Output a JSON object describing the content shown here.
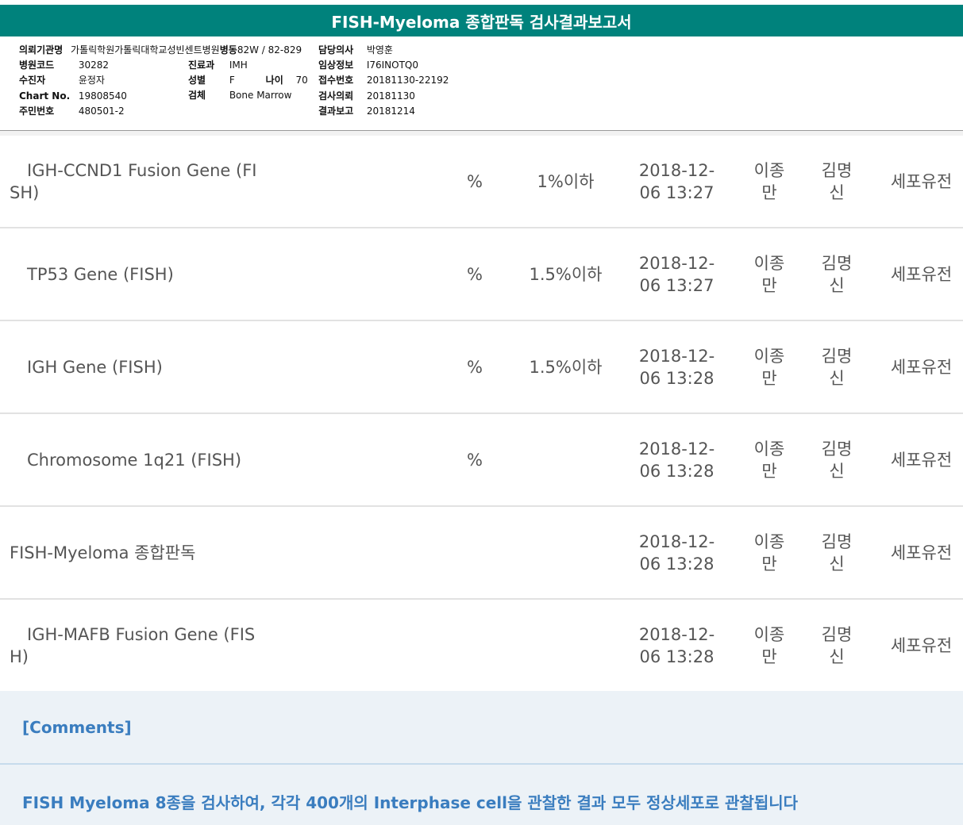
{
  "report": {
    "title": "FISH-Myeloma 종합판독 검사결과보고서"
  },
  "header": {
    "hospital_label": "의뢰기관명",
    "hospital_value": "가톨릭학원가톨릭대학교성빈센트병원",
    "ward_label": "병동",
    "ward_value": "82W / 82-829",
    "hospital_code_label": "병원코드",
    "hospital_code_value": "30282",
    "patient_label": "수진자",
    "patient_value": "윤정자",
    "chart_label": "Chart No.",
    "chart_value": "19808540",
    "id_label": "주민번호",
    "id_value": "480501-2",
    "dept_label": "진료과",
    "dept_value": "IMH",
    "sex_label": "성별",
    "sex_value": "F",
    "age_label": "나이",
    "age_value": "70",
    "specimen_label": "검체",
    "specimen_value": "Bone Marrow",
    "doctor_label": "담당의사",
    "doctor_value": "박영훈",
    "clinical_label": "임상정보",
    "clinical_value": "I76INOTQ0",
    "receipt_label": "접수번호",
    "receipt_value": "20181130-22192",
    "request_label": "검사의뢰",
    "request_value": "20181130",
    "report_label": "결과보고",
    "report_value": "20181214"
  },
  "results": [
    {
      "name": "IGH-CCND1 Fusion Gene (FI\nSH)",
      "indent": true,
      "unit": "%",
      "reference": "1%이하",
      "datetime": "2018-12-\n06 13:27",
      "person1": "이종\n만",
      "person2": "김명\n신",
      "dept": "세포유전"
    },
    {
      "name": "TP53 Gene (FISH)",
      "indent": true,
      "unit": "%",
      "reference": "1.5%이하",
      "datetime": "2018-12-\n06 13:27",
      "person1": "이종\n만",
      "person2": "김명\n신",
      "dept": "세포유전"
    },
    {
      "name": "IGH Gene (FISH)",
      "indent": true,
      "unit": "%",
      "reference": "1.5%이하",
      "datetime": "2018-12-\n06 13:28",
      "person1": "이종\n만",
      "person2": "김명\n신",
      "dept": "세포유전"
    },
    {
      "name": "Chromosome 1q21 (FISH)",
      "indent": true,
      "unit": "%",
      "reference": "",
      "datetime": "2018-12-\n06 13:28",
      "person1": "이종\n만",
      "person2": "김명\n신",
      "dept": "세포유전"
    },
    {
      "name": "FISH-Myeloma 종합판독",
      "indent": false,
      "unit": "",
      "reference": "",
      "datetime": "2018-12-\n06 13:28",
      "person1": "이종\n만",
      "person2": "김명\n신",
      "dept": "세포유전"
    },
    {
      "name": "IGH-MAFB Fusion Gene (FIS\nH)",
      "indent": true,
      "unit": "",
      "reference": "",
      "datetime": "2018-12-\n06 13:28",
      "person1": "이종\n만",
      "person2": "김명\n신",
      "dept": "세포유전"
    }
  ],
  "comments": {
    "title": "[Comments]",
    "text": "FISH Myeloma 8종을 검사하여, 각각 400개의 Interphase cell을 관찰한 결과 모두 정상세포로 관찰됩니다"
  }
}
